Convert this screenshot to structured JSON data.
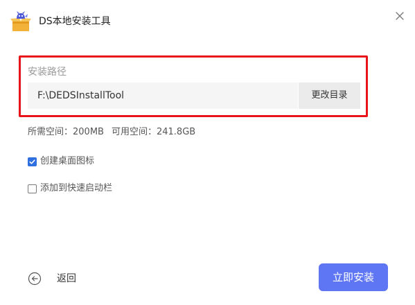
{
  "window": {
    "title": "DS本地安装工具",
    "app_icon": "ds-box-icon",
    "close_icon": "close-icon"
  },
  "install_path": {
    "label": "安装路径",
    "value": "F:\\DEDSInstallTool",
    "change_button_label": "更改目录",
    "highlight_color": "#e8141a"
  },
  "space": {
    "required_label": "所需空间：",
    "required_value": "200MB",
    "available_label": "可用空间：",
    "available_value": "241.8GB"
  },
  "options": [
    {
      "label": "创建桌面图标",
      "checked": true
    },
    {
      "label": "添加到快速启动栏",
      "checked": false
    }
  ],
  "footer": {
    "back_label": "返回",
    "back_icon": "arrow-left-circle-icon",
    "install_label": "立即安装",
    "install_color": "#5e76f4"
  },
  "colors": {
    "checkbox_checked": "#2f6fe0",
    "path_field_bg": "#f5f5f5",
    "button_bg": "#ebebeb"
  }
}
